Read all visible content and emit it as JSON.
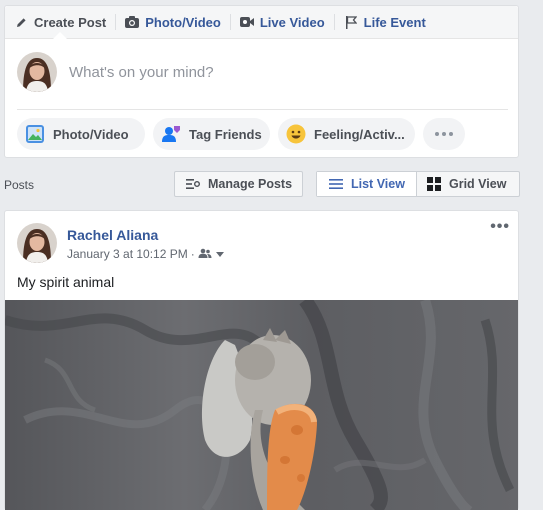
{
  "composer": {
    "tabs": [
      {
        "label": "Create Post",
        "icon": "pencil-icon"
      },
      {
        "label": "Photo/Video",
        "icon": "camera-icon"
      },
      {
        "label": "Live Video",
        "icon": "video-camera-icon"
      },
      {
        "label": "Life Event",
        "icon": "flag-icon"
      }
    ],
    "placeholder": "What's on your mind?",
    "actions": [
      {
        "label": "Photo/Video",
        "icon": "photo-icon"
      },
      {
        "label": "Tag Friends",
        "icon": "tag-friends-icon"
      },
      {
        "label": "Feeling/Activ...",
        "icon": "smiley-icon"
      },
      {
        "label": "",
        "icon": "more-icon"
      }
    ]
  },
  "posts_bar": {
    "label": "Posts",
    "manage_label": "Manage Posts",
    "list_view_label": "List View",
    "grid_view_label": "Grid View"
  },
  "post": {
    "author": "Rachel Aliana",
    "timestamp": "January 3 at 10:12 PM",
    "separator": "·",
    "text": "My spirit animal"
  },
  "colors": {
    "link_blue": "#365899",
    "accent_blue": "#4267b2",
    "background": "#e9ebee"
  }
}
